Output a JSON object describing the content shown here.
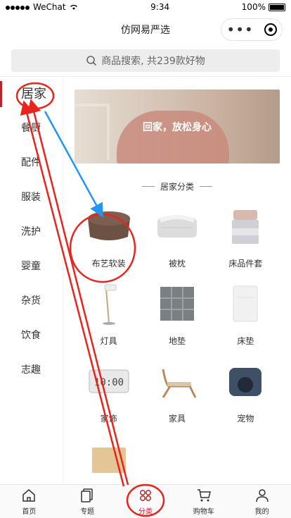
{
  "status": {
    "carrier": "WeChat",
    "time": "9:34",
    "battery": "100%"
  },
  "nav": {
    "title": "仿网易严选"
  },
  "search": {
    "placeholder": "商品搜索, 共239款好物"
  },
  "sidebar": {
    "items": [
      {
        "label": "居家",
        "active": true
      },
      {
        "label": "餐厨"
      },
      {
        "label": "配件"
      },
      {
        "label": "服装"
      },
      {
        "label": "洗护"
      },
      {
        "label": "婴童"
      },
      {
        "label": "杂货"
      },
      {
        "label": "饮食"
      },
      {
        "label": "志趣"
      }
    ]
  },
  "banner": {
    "text": "回家，放松身心"
  },
  "section": {
    "title": "居家分类"
  },
  "categories": [
    {
      "label": "布艺软装",
      "icon": "pouf-icon"
    },
    {
      "label": "被枕",
      "icon": "quilt-icon"
    },
    {
      "label": "床品件套",
      "icon": "bedding-set-icon"
    },
    {
      "label": "灯具",
      "icon": "lamp-icon"
    },
    {
      "label": "地垫",
      "icon": "floor-mat-icon"
    },
    {
      "label": "床垫",
      "icon": "mattress-icon"
    },
    {
      "label": "家饰",
      "icon": "clock-icon"
    },
    {
      "label": "家具",
      "icon": "chair-icon"
    },
    {
      "label": "宠物",
      "icon": "pet-house-icon"
    }
  ],
  "tabs": [
    {
      "label": "首页",
      "icon": "home-icon"
    },
    {
      "label": "专题",
      "icon": "topic-icon"
    },
    {
      "label": "分类",
      "icon": "category-icon",
      "active": true
    },
    {
      "label": "购物车",
      "icon": "cart-icon"
    },
    {
      "label": "我的",
      "icon": "user-icon"
    }
  ],
  "colors": {
    "accent": "#b4282d",
    "annotation_red": "#e8241c",
    "annotation_blue": "#2196f3"
  }
}
